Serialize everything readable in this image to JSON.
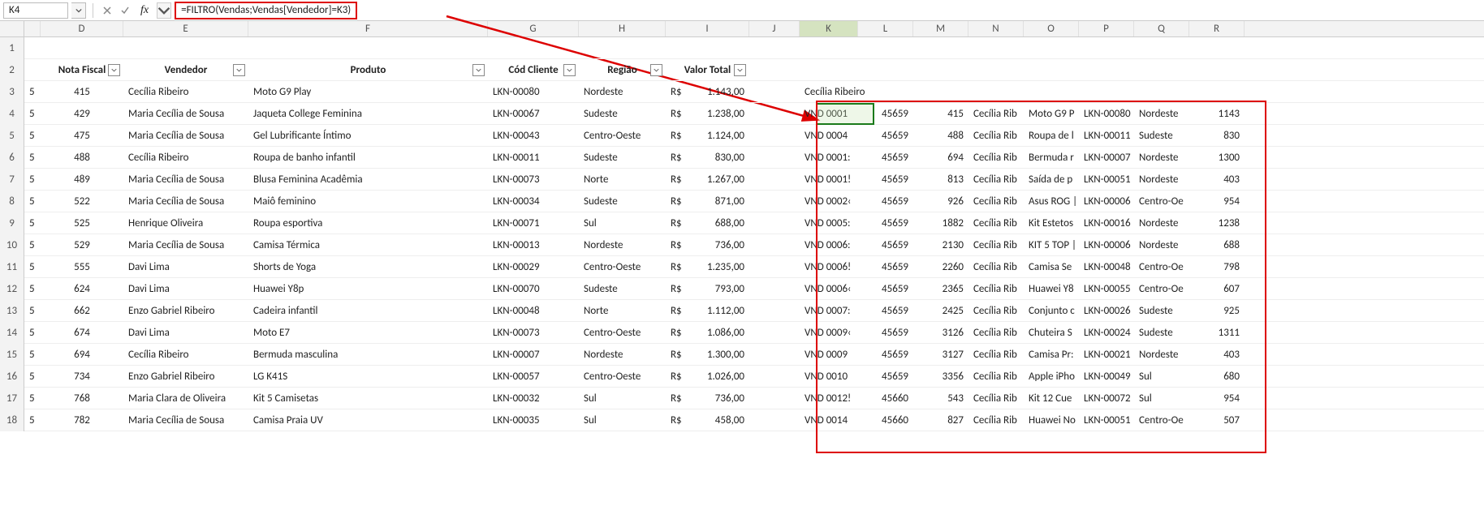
{
  "namebox": "K4",
  "formula": "=FILTRO(Vendas;Vendas[Vendedor]=K3)",
  "cols": [
    "D",
    "E",
    "F",
    "G",
    "H",
    "I",
    "J",
    "K",
    "L",
    "M",
    "N",
    "O",
    "P",
    "Q",
    "R"
  ],
  "headers": {
    "nf": "Nota Fiscal",
    "vend": "Vendedor",
    "prod": "Produto",
    "cod": "Cód Cliente",
    "reg": "Região",
    "val": "Valor Total"
  },
  "k3": "Cecília Ribeiro",
  "main": [
    {
      "r": 3,
      "nf": "415",
      "v": "Cecília Ribeiro",
      "p": "Moto G9 Play",
      "c": "LKN-00080",
      "g": "Nordeste",
      "cur": "R$",
      "t": "1.143,00"
    },
    {
      "r": 4,
      "nf": "429",
      "v": "Maria Cecília de Sousa",
      "p": "Jaqueta College Feminina",
      "c": "LKN-00067",
      "g": "Sudeste",
      "cur": "R$",
      "t": "1.238,00"
    },
    {
      "r": 5,
      "nf": "475",
      "v": "Maria Cecília de Sousa",
      "p": "Gel Lubrificante Íntimo",
      "c": "LKN-00043",
      "g": "Centro-Oeste",
      "cur": "R$",
      "t": "1.124,00"
    },
    {
      "r": 6,
      "nf": "488",
      "v": "Cecília Ribeiro",
      "p": "Roupa de banho infantil",
      "c": "LKN-00011",
      "g": "Sudeste",
      "cur": "R$",
      "t": "830,00"
    },
    {
      "r": 7,
      "nf": "489",
      "v": "Maria Cecília de Sousa",
      "p": "Blusa Feminina Acadêmia",
      "c": "LKN-00073",
      "g": "Norte",
      "cur": "R$",
      "t": "1.267,00"
    },
    {
      "r": 8,
      "nf": "522",
      "v": "Maria Cecília de Sousa",
      "p": "Maiô feminino",
      "c": "LKN-00034",
      "g": "Sudeste",
      "cur": "R$",
      "t": "871,00"
    },
    {
      "r": 9,
      "nf": "525",
      "v": "Henrique Oliveira",
      "p": "Roupa esportiva",
      "c": "LKN-00071",
      "g": "Sul",
      "cur": "R$",
      "t": "688,00"
    },
    {
      "r": 10,
      "nf": "529",
      "v": "Maria Cecília de Sousa",
      "p": "Camisa Térmica",
      "c": "LKN-00013",
      "g": "Nordeste",
      "cur": "R$",
      "t": "736,00"
    },
    {
      "r": 11,
      "nf": "555",
      "v": "Davi Lima",
      "p": "Shorts de Yoga",
      "c": "LKN-00029",
      "g": "Centro-Oeste",
      "cur": "R$",
      "t": "1.235,00"
    },
    {
      "r": 12,
      "nf": "624",
      "v": "Davi Lima",
      "p": "Huawei Y8p",
      "c": "LKN-00070",
      "g": "Sudeste",
      "cur": "R$",
      "t": "793,00"
    },
    {
      "r": 13,
      "nf": "662",
      "v": "Enzo Gabriel Ribeiro",
      "p": "Cadeira infantil",
      "c": "LKN-00048",
      "g": "Norte",
      "cur": "R$",
      "t": "1.112,00"
    },
    {
      "r": 14,
      "nf": "674",
      "v": "Davi Lima",
      "p": "Moto E7",
      "c": "LKN-00073",
      "g": "Centro-Oeste",
      "cur": "R$",
      "t": "1.086,00"
    },
    {
      "r": 15,
      "nf": "694",
      "v": "Cecília Ribeiro",
      "p": "Bermuda masculina",
      "c": "LKN-00007",
      "g": "Nordeste",
      "cur": "R$",
      "t": "1.300,00"
    },
    {
      "r": 16,
      "nf": "734",
      "v": "Enzo Gabriel Ribeiro",
      "p": "LG K41S",
      "c": "LKN-00057",
      "g": "Centro-Oeste",
      "cur": "R$",
      "t": "1.026,00"
    },
    {
      "r": 17,
      "nf": "768",
      "v": "Maria Clara de Oliveira",
      "p": "Kit 5 Camisetas",
      "c": "LKN-00032",
      "g": "Sul",
      "cur": "R$",
      "t": "736,00"
    },
    {
      "r": 18,
      "nf": "782",
      "v": "Maria Cecília de Sousa",
      "p": "Camisa Praia UV",
      "c": "LKN-00035",
      "g": "Sul",
      "cur": "R$",
      "t": "458,00"
    }
  ],
  "filt": [
    {
      "k": "VND 0001",
      "l": "45659",
      "m": "415",
      "n": "Cecília Rib",
      "o": "Moto G9 P",
      "p": "LKN-00080",
      "q": "Nordeste",
      "r": "1143"
    },
    {
      "k": "VND 0004",
      "l": "45659",
      "m": "488",
      "n": "Cecília Rib",
      "o": "Roupa de l",
      "p": "LKN-00011",
      "q": "Sudeste",
      "r": "830"
    },
    {
      "k": "VND 0001:",
      "l": "45659",
      "m": "694",
      "n": "Cecília Rib",
      "o": "Bermuda r",
      "p": "LKN-00007",
      "q": "Nordeste",
      "r": "1300"
    },
    {
      "k": "VND 0001!",
      "l": "45659",
      "m": "813",
      "n": "Cecília Rib",
      "o": "Saída de p",
      "p": "LKN-00051",
      "q": "Nordeste",
      "r": "403"
    },
    {
      "k": "VND 0002‹",
      "l": "45659",
      "m": "926",
      "n": "Cecília Rib",
      "o": "Asus ROG |",
      "p": "LKN-00006",
      "q": "Centro-Oe",
      "r": "954"
    },
    {
      "k": "VND 0005:",
      "l": "45659",
      "m": "1882",
      "n": "Cecília Rib",
      "o": "Kit Estetos",
      "p": "LKN-00016",
      "q": "Nordeste",
      "r": "1238"
    },
    {
      "k": "VND 0006:",
      "l": "45659",
      "m": "2130",
      "n": "Cecília Rib",
      "o": "KIT 5 TOP |",
      "p": "LKN-00006",
      "q": "Nordeste",
      "r": "688"
    },
    {
      "k": "VND 0006!",
      "l": "45659",
      "m": "2260",
      "n": "Cecília Rib",
      "o": "Camisa Se",
      "p": "LKN-00048",
      "q": "Centro-Oe",
      "r": "798"
    },
    {
      "k": "VND 0006‹",
      "l": "45659",
      "m": "2365",
      "n": "Cecília Rib",
      "o": "Huawei Y8",
      "p": "LKN-00055",
      "q": "Centro-Oe",
      "r": "607"
    },
    {
      "k": "VND 0007:",
      "l": "45659",
      "m": "2425",
      "n": "Cecília Rib",
      "o": "Conjunto c",
      "p": "LKN-00026",
      "q": "Sudeste",
      "r": "925"
    },
    {
      "k": "VND 0009‹",
      "l": "45659",
      "m": "3126",
      "n": "Cecília Rib",
      "o": "Chuteira S",
      "p": "LKN-00024",
      "q": "Sudeste",
      "r": "1311"
    },
    {
      "k": "VND 0009",
      "l": "45659",
      "m": "3127",
      "n": "Cecília Rib",
      "o": "Camisa Pr:",
      "p": "LKN-00021",
      "q": "Nordeste",
      "r": "403"
    },
    {
      "k": "VND 0010",
      "l": "45659",
      "m": "3356",
      "n": "Cecília Rib",
      "o": "Apple iPho",
      "p": "LKN-00049",
      "q": "Sul",
      "r": "680"
    },
    {
      "k": "VND 0012!",
      "l": "45660",
      "m": "543",
      "n": "Cecília Rib",
      "o": "Kit 12 Cue",
      "p": "LKN-00072",
      "q": "Sul",
      "r": "954"
    },
    {
      "k": "VND 0014",
      "l": "45660",
      "m": "827",
      "n": "Cecília Rib",
      "o": "Huawei No",
      "p": "LKN-00051",
      "q": "Centro-Oe",
      "r": "507"
    }
  ]
}
